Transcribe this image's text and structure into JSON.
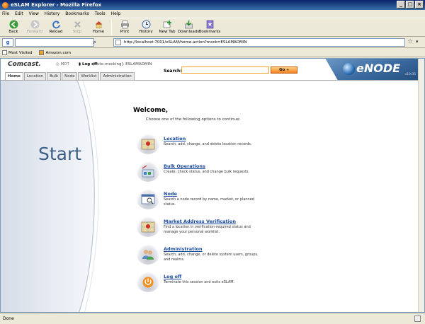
{
  "window": {
    "title": "eSLAM Explorer - Mozilla Firefox",
    "controls": {
      "minimize": "_",
      "maximize": "□",
      "close": "×"
    }
  },
  "menu": [
    "File",
    "Edit",
    "View",
    "History",
    "Bookmarks",
    "Tools",
    "Help"
  ],
  "toolbar": {
    "back": "Back",
    "forward": "Forward",
    "reload": "Reload",
    "stop": "Stop",
    "home": "Home",
    "print": "Print",
    "history": "History",
    "new_tab": "New Tab",
    "downloads": "Downloads",
    "bookmarks": "Bookmarks"
  },
  "address": {
    "url": "http://localhost:7001/eSLAM/home.action?mock=ESLAMADMIN"
  },
  "bookmarks_bar": [
    "Most Visited",
    "Amazon.com"
  ],
  "app": {
    "brand": "Comcast.",
    "mdt": "MDT",
    "logoff_link": "Log off",
    "auto_mock": "[Auto-mocking]: ESLAMADMIN",
    "search_label": "Search:",
    "search_value": "",
    "go_label": "Go »",
    "product": "eNODE",
    "version": "v10.05",
    "tabs": [
      "Home",
      "Location",
      "Bulk",
      "Node",
      "Worklist",
      "Administration"
    ],
    "active_tab": "Home"
  },
  "main": {
    "start": "Start",
    "welcome": "Welcome,",
    "choose": "Choose one of the following options to continue:",
    "options": [
      {
        "title": "Location",
        "desc": "Search, add, change, and delete location records.",
        "icon": "map-icon"
      },
      {
        "title": "Bulk Operations",
        "desc": "Create, check status, and change bulk requests.",
        "icon": "bulk-icon"
      },
      {
        "title": "Node",
        "desc": "Search a node record by name, market, or planned status.",
        "icon": "node-icon"
      },
      {
        "title": "Market Address Verification",
        "desc": "Find a location in verification-required status and manage your personal worklist.",
        "icon": "map-icon"
      },
      {
        "title": "Administration",
        "desc": "Search, add, change, or delete system users, groups, and realms.",
        "icon": "users-icon"
      },
      {
        "title": "Log off",
        "desc": "Terminate this session and exits eSLAM.",
        "icon": "power-icon"
      }
    ]
  },
  "status": {
    "text": "Done"
  },
  "colors": {
    "link": "#1b4aa0",
    "start_text": "#3d5f85",
    "go_button": "#f08020"
  }
}
